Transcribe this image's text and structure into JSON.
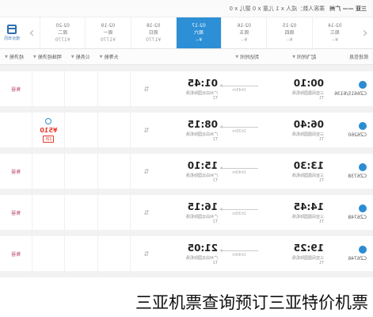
{
  "topbar": {
    "route": "三亚 —— 广州",
    "passengers": "乘客人数：成人 x 1 儿童 x 0 婴儿 x 0"
  },
  "dates": [
    {
      "date": "02-14",
      "weekday": "周三",
      "price": "¥--"
    },
    {
      "date": "02-15",
      "weekday": "周四",
      "price": "¥--"
    },
    {
      "date": "02-16",
      "weekday": "周五",
      "price": "¥--"
    },
    {
      "date": "02-17",
      "weekday": "周六",
      "price": "¥--",
      "active": true
    },
    {
      "date": "02-18",
      "weekday": "周日",
      "price": "¥1770"
    },
    {
      "date": "02-19",
      "weekday": "周一",
      "price": "¥1770"
    },
    {
      "date": "02-20",
      "weekday": "周二",
      "price": "¥1770"
    }
  ],
  "calendar_label": "低价日历",
  "filters": [
    "航班信息",
    "起飞时间",
    "到达时间",
    "头等舱",
    "公务舱",
    "明珠经济舱",
    "经济舱"
  ],
  "flights": [
    {
      "fno": "CZ6615/6136",
      "dep": "00:10",
      "dep_ap": "三亚凤凰国际机场",
      "dep_term": "T1",
      "dur": "1h45m",
      "arr": "01:45",
      "arr_ap": "广州白云国际机场",
      "arr_term": "T2",
      "price": "",
      "rate": "",
      "status": "售罄"
    },
    {
      "fno": "CZ6260",
      "dep": "06:40",
      "dep_ap": "三亚凤凰国际机场",
      "dep_term": "T1",
      "dur": "1h35m",
      "arr": "08:15",
      "arr_ap": "广州白云国际机场",
      "arr_term": "T2",
      "price": "¥510",
      "rate": "2折",
      "status": ""
    },
    {
      "fno": "CZ6738",
      "dep": "13:30",
      "dep_ap": "三亚凤凰国际机场",
      "dep_term": "T1",
      "dur": "1h40m",
      "arr": "15:10",
      "arr_ap": "广州白云国际机场",
      "arr_term": "T2",
      "price": "",
      "rate": "",
      "status": "售罄"
    },
    {
      "fno": "CZ6748",
      "dep": "14:45",
      "dep_ap": "三亚凤凰国际机场",
      "dep_term": "T1",
      "dur": "1h30m",
      "arr": "16:15",
      "arr_ap": "广州白云国际机场",
      "arr_term": "T2",
      "price": "",
      "rate": "",
      "status": "售罄"
    },
    {
      "fno": "CZ6746",
      "dep": "19:25",
      "dep_ap": "三亚凤凰国际机场",
      "dep_term": "T1",
      "dur": "1h40m",
      "arr": "21:05",
      "arr_ap": "广州白云国际机场",
      "arr_term": "T2",
      "price": "",
      "rate": "",
      "status": "售罄"
    }
  ],
  "caption": "三亚机票查询预订三亚特价机票",
  "colors": {
    "accent": "#2d8fd6",
    "price": "#e63b2e",
    "soldout": "#c0547a"
  }
}
